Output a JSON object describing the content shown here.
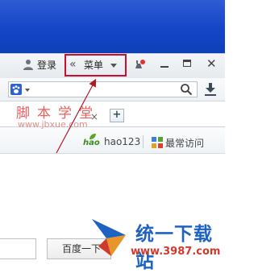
{
  "titlebar": {
    "login_label": "登录",
    "collapse_glyph": "«",
    "menu_label": "菜单",
    "close_glyph": "✕"
  },
  "watermark": {
    "cn_text": "脚本学堂",
    "url_text": "www.jbxue.com"
  },
  "tabs": {
    "close_glyph": "×",
    "new_tab_glyph": "+"
  },
  "bookmarks": {
    "hao_logo_text": "hao",
    "hao123_label": "hao123",
    "frequent_label": "最常访问"
  },
  "content": {
    "baidu_button_label": "百度一下"
  },
  "site_logo": {
    "name": "统一下载站",
    "url": "www.3987.com"
  },
  "colors": {
    "highlight_border": "#c8102e",
    "annotation_arrow": "#b0182a",
    "top_blue": "#1446c7",
    "site_name_blue": "#1e63c2",
    "site_url_red": "#d03a2c"
  },
  "icons": [
    "user-icon",
    "chevron-left-double-icon",
    "caret-down-icon",
    "notification-icon",
    "minimize-icon",
    "maximize-icon",
    "close-icon",
    "paw-icon",
    "search-icon",
    "download-icon",
    "plus-icon",
    "grid-icon"
  ]
}
